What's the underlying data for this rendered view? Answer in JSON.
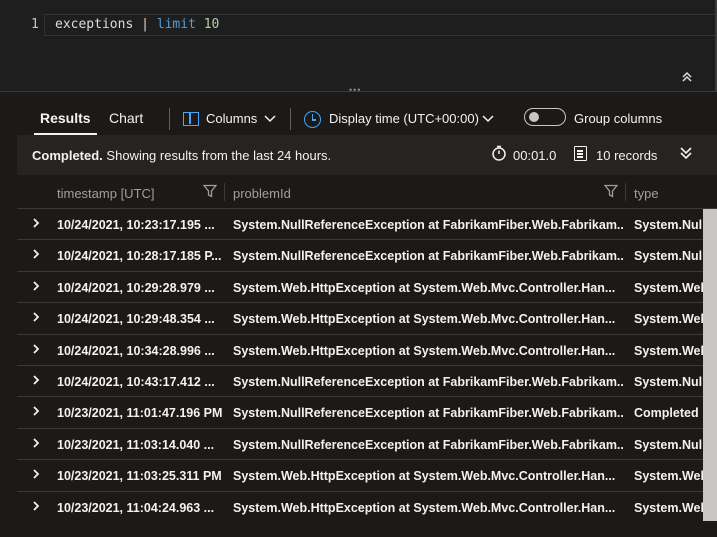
{
  "editor": {
    "line_number": "1",
    "tokens": {
      "table": "exceptions",
      "pipe": "|",
      "operator": "limit",
      "count": "10"
    }
  },
  "toolbar": {
    "tab_results": "Results",
    "tab_chart": "Chart",
    "columns_label": "Columns",
    "display_time_label": "Display time (UTC+00:00)",
    "group_columns_label": "Group columns",
    "group_columns_on": false
  },
  "status": {
    "completed": "Completed.",
    "message": "Showing results from the last 24 hours.",
    "duration": "00:01.0",
    "records": "10 records"
  },
  "grid": {
    "columns": [
      "timestamp [UTC]",
      "problemId",
      "type"
    ],
    "rows": [
      [
        "10/24/2021, 10:23:17.195 ...",
        "System.NullReferenceException at FabrikamFiber.Web.Fabrikam...",
        "System.Nul"
      ],
      [
        "10/24/2021, 10:28:17.185 P...",
        "System.NullReferenceException at FabrikamFiber.Web.Fabrikam...",
        "System.Nul"
      ],
      [
        "10/24/2021, 10:29:28.979 ...",
        "System.Web.HttpException at System.Web.Mvc.Controller.Han...",
        "System.Web"
      ],
      [
        "10/24/2021, 10:29:48.354 ...",
        "System.Web.HttpException at System.Web.Mvc.Controller.Han...",
        "System.Web"
      ],
      [
        "10/24/2021, 10:34:28.996 ...",
        "System.Web.HttpException at System.Web.Mvc.Controller.Han...",
        "System.Web"
      ],
      [
        "10/24/2021, 10:43:17.412 ...",
        "System.NullReferenceException at FabrikamFiber.Web.Fabrikam...",
        "System.Nul"
      ],
      [
        "10/23/2021, 11:01:47.196 PM",
        "System.NullReferenceException at FabrikamFiber.Web.Fabrikam...",
        "Completed"
      ],
      [
        "10/23/2021, 11:03:14.040 ...",
        "System.NullReferenceException at FabrikamFiber.Web.Fabrikam...",
        "System.Nul"
      ],
      [
        "10/23/2021, 11:03:25.311 PM",
        "System.Web.HttpException at System.Web.Mvc.Controller.Han...",
        "System.Web"
      ],
      [
        "10/23/2021, 11:04:24.963 ...",
        "System.Web.HttpException at System.Web.Mvc.Controller.Han...",
        "System.Web"
      ]
    ]
  },
  "colors": {
    "accent": "#4aa4f5",
    "keyword": "#569cd6",
    "number": "#b5cea8"
  }
}
